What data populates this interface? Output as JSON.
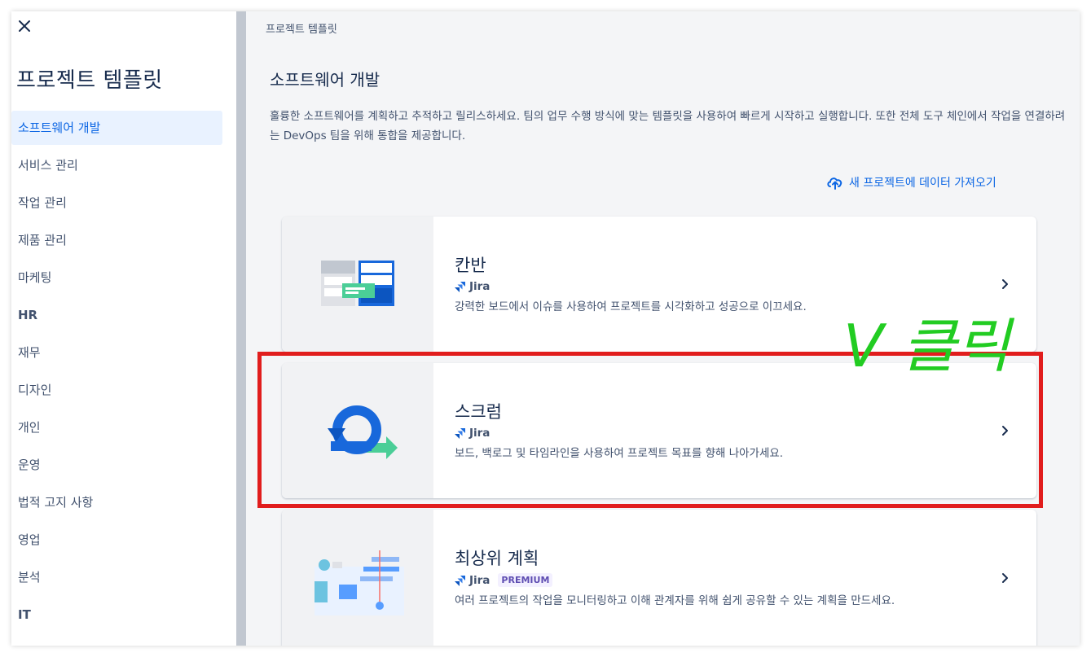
{
  "sidebar": {
    "title": "프로젝트 템플릿",
    "items": [
      {
        "label": "소프트웨어 개발",
        "active": true
      },
      {
        "label": "서비스 관리"
      },
      {
        "label": "작업 관리"
      },
      {
        "label": "제품 관리"
      },
      {
        "label": "마케팅"
      },
      {
        "label": "HR",
        "bold": true
      },
      {
        "label": "재무"
      },
      {
        "label": "디자인"
      },
      {
        "label": "개인"
      },
      {
        "label": "운영"
      },
      {
        "label": "법적 고지 사항"
      },
      {
        "label": "영업"
      },
      {
        "label": "분석"
      },
      {
        "label": "IT",
        "bold": true
      }
    ]
  },
  "main": {
    "breadcrumb": "프로젝트 템플릿",
    "title": "소프트웨어 개발",
    "description": "훌륭한 소프트웨어를 계획하고 추적하고 릴리스하세요. 팀의 업무 수행 방식에 맞는 템플릿을 사용하여 빠르게 시작하고 실행합니다. 또한 전체 도구 체인에서 작업을 연결하려는 DevOps 팀을 위해 통합을 제공합니다.",
    "import_link": "새 프로젝트에 데이터 가져오기",
    "cards": [
      {
        "title": "칸반",
        "product": "Jira",
        "description": "강력한 보드에서 이슈를 사용하여 프로젝트를 시각화하고 성공으로 이끄세요."
      },
      {
        "title": "스크럼",
        "product": "Jira",
        "description": "보드, 백로그 및 타임라인을 사용하여 프로젝트 목표를 향해 나아가세요."
      },
      {
        "title": "최상위 계획",
        "product": "Jira",
        "badge": "PREMIUM",
        "description": "여러 프로젝트의 작업을 모니터링하고 이해 관계자를 위해 쉽게 공유할 수 있는 계획을 만드세요."
      }
    ]
  },
  "annotation": {
    "text": "V 클릭",
    "color": "#22cc22"
  },
  "colors": {
    "accent": "#0c66e4",
    "highlight": "#e11d1d",
    "active_bg": "#e9f2ff"
  }
}
